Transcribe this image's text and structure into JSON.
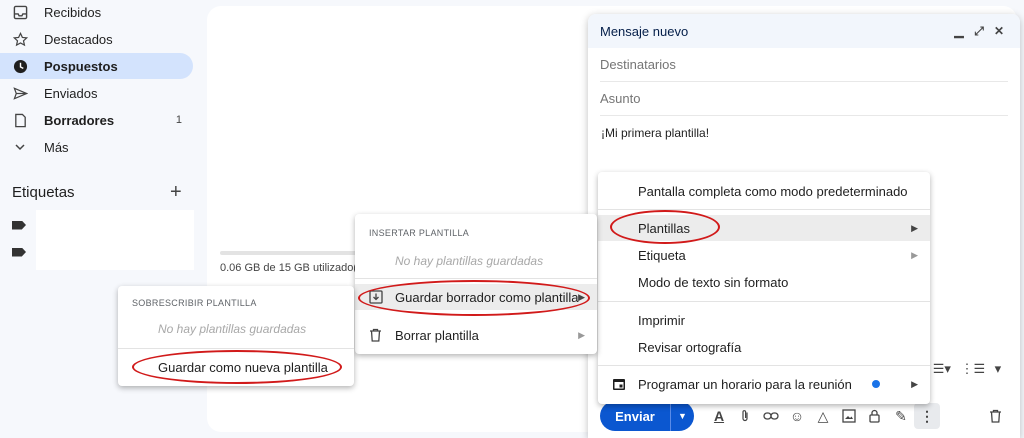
{
  "sidebar": {
    "items": [
      {
        "label": "Recibidos",
        "icon": "inbox-icon"
      },
      {
        "label": "Destacados",
        "icon": "star-icon"
      },
      {
        "label": "Pospuestos",
        "icon": "clock-icon"
      },
      {
        "label": "Enviados",
        "icon": "send-icon"
      },
      {
        "label": "Borradores",
        "icon": "draft-icon",
        "count": "1"
      },
      {
        "label": "Más",
        "icon": "chevron-down-icon"
      }
    ],
    "labels_title": "Etiquetas",
    "labels_add": "+"
  },
  "storage": {
    "text": "0.06 GB de 15 GB utilizado(s)"
  },
  "compose": {
    "title": "Mensaje nuevo",
    "to_placeholder": "Destinatarios",
    "subject_placeholder": "Asunto",
    "body": "¡Mi primera plantilla!",
    "send_label": "Enviar"
  },
  "more_menu": {
    "items": [
      {
        "label": "Pantalla completa como modo predeterminado"
      },
      {
        "label": "Plantillas",
        "submenu": true
      },
      {
        "label": "Etiqueta",
        "submenu": true
      },
      {
        "label": "Modo de texto sin formato"
      },
      {
        "label": "Imprimir"
      },
      {
        "label": "Revisar ortografía"
      },
      {
        "label": "Programar un horario para la reunión",
        "submenu": true
      }
    ]
  },
  "templates_menu": {
    "section": "INSERTAR PLANTILLA",
    "empty": "No hay plantillas guardadas",
    "save_draft": "Guardar borrador como plantilla",
    "delete": "Borrar plantilla"
  },
  "overwrite_menu": {
    "section": "SOBRESCRIBIR PLANTILLA",
    "empty": "No hay plantillas guardadas",
    "save_new": "Guardar como nueva plantilla"
  },
  "colors": {
    "accent": "#0b57d0",
    "highlight_ring": "#d11a1a",
    "active_nav": "#d3e3fd"
  }
}
